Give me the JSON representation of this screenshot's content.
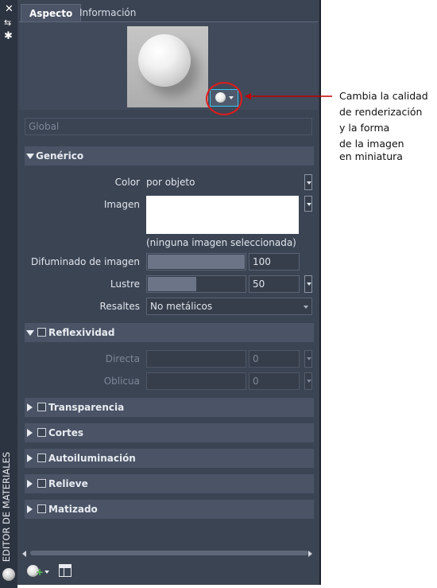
{
  "window": {
    "title": "EDITOR DE MATERIALES"
  },
  "tabs": [
    {
      "label": "Aspecto",
      "active": true
    },
    {
      "label": "Información",
      "active": false
    }
  ],
  "global_field": {
    "placeholder": "Global"
  },
  "generic": {
    "title": "Genérico",
    "color_label": "Color",
    "color_value": "por objeto",
    "image_label": "Imagen",
    "image_note": "(ninguna imagen seleccionada)",
    "fade_label": "Difuminado de imagen",
    "fade_value": "100",
    "fade_level": 1.0,
    "gloss_label": "Lustre",
    "gloss_value": "50",
    "gloss_level": 0.5,
    "highlights_label": "Resaltes",
    "highlights_value": "No metálicos"
  },
  "reflectivity": {
    "title": "Reflexividad",
    "direct_label": "Directa",
    "direct_value": "0",
    "oblique_label": "Oblicua",
    "oblique_value": "0"
  },
  "sections": [
    "Transparencia",
    "Cortes",
    "Autoiluminación",
    "Relieve",
    "Matizado"
  ],
  "annotation": {
    "lines": [
      "Cambia la calidad",
      "de renderización",
      "y la forma",
      "de la imagen",
      "en miniatura"
    ],
    "color": "#c00000"
  },
  "colors": {
    "panel": "#3b4453",
    "accent": "#35c5f0",
    "highlight": "#e01b1b"
  }
}
